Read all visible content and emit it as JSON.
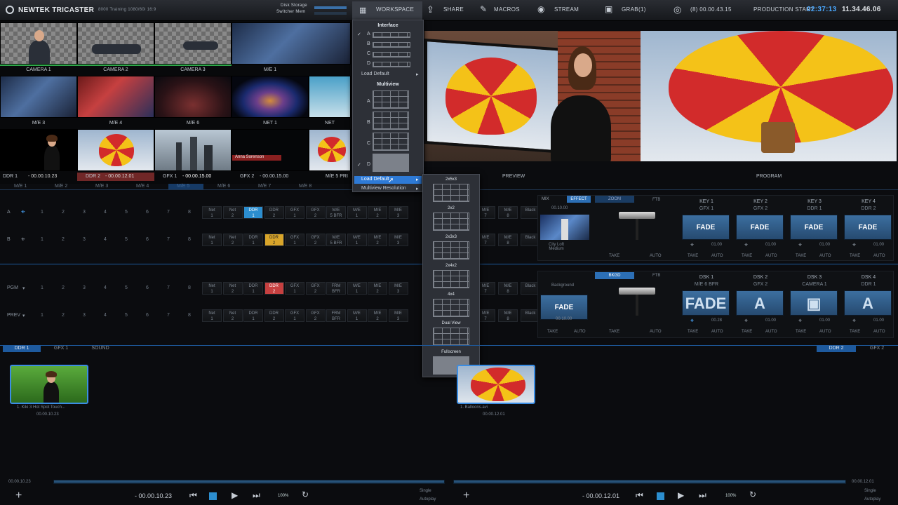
{
  "topbar": {
    "app": "NewTek TriCaster",
    "session": "8000 Training   1080/60i 16:9",
    "disk": "Disk Storage",
    "switcher": "Switcher Mem",
    "workspace": "WORKSPACE",
    "share": "SHARE",
    "macros": "MACROS",
    "stream": "STREAM",
    "grab": "GRAB",
    "grab_count": "(1)",
    "rec": "(8)  00.00.43.15",
    "prod_label": "PRODUCTION START",
    "prod_time": "02:37:13",
    "clock": "11.34.46.06"
  },
  "multiview": {
    "row1": [
      "CAMERA 1",
      "CAMERA 2",
      "CAMERA 3",
      "M/E 1"
    ],
    "row2": [
      "M/E 3",
      "M/E 4",
      "M/E 6",
      "NET 1",
      "NET"
    ],
    "row3": [
      "DDR 1",
      "DDR 2",
      "GFX 1",
      "GFX 2"
    ],
    "row3_times": [
      "- 00.00.10.23",
      "- 00.00.12.01",
      "- 00.00.15.00",
      "- 00.00.15.00"
    ],
    "preview": "PREVIEW",
    "program": "PROGRAM",
    "me5": "M/E 5 PRI",
    "caption": "Anna Sorenson"
  },
  "me_tabs": [
    "M/E 1",
    "M/E 2",
    "M/E 3",
    "M/E 4",
    "M/E 5",
    "M/E 6",
    "M/E 7",
    "M/E 8"
  ],
  "rows": {
    "a": "A",
    "b": "B",
    "pgm": "PGM",
    "prev": "PREV"
  },
  "buttons": [
    "1",
    "2",
    "3",
    "4",
    "5",
    "6",
    "7",
    "8"
  ],
  "src_labels": [
    "Net\n1",
    "Net\n2",
    "DDR\n1",
    "DDR\n2",
    "GFX\n1",
    "GFX\n2",
    "M/E\n5 BFR",
    "M/E\n1",
    "M/E\n2",
    "M/E\n3"
  ],
  "src_labels_pgm": [
    "Net\n1",
    "Net\n2",
    "DDR\n1",
    "DDR\n2",
    "GFX\n1",
    "GFX\n2",
    "FRM\nBFR",
    "M/E\n1",
    "M/E\n2",
    "M/E\n3"
  ],
  "me_right": [
    "M/E\n7",
    "M/E\n8",
    "Black"
  ],
  "transition": {
    "mix": "MIX",
    "effect": "EFFECT",
    "zoom": "ZOOM",
    "ftb": "FTB",
    "bkgd": "BKGD",
    "background": "Background",
    "city": "City Loft\nMedium",
    "time": "00.10.00",
    "fade": "FADE",
    "take": "TAKE",
    "auto": "AUTO",
    "rate": "01.00"
  },
  "keys": [
    {
      "t": "KEY 1",
      "s": "GFX 1"
    },
    {
      "t": "KEY 2",
      "s": "GFX 2"
    },
    {
      "t": "KEY 3",
      "s": "DDR 1"
    },
    {
      "t": "KEY 4",
      "s": "DDR 2"
    }
  ],
  "dsk": [
    {
      "t": "DSK 1",
      "s": "M/E 6 BFR"
    },
    {
      "t": "DSK 2",
      "s": "GFX 2"
    },
    {
      "t": "DSK 3",
      "s": "CAMERA 1"
    },
    {
      "t": "DSK 4",
      "s": "DDR 1"
    }
  ],
  "dsk_rate": "00.28",
  "media_tabs": [
    "DDR 1",
    "GFX 1",
    "SOUND"
  ],
  "media_tabs_r": [
    "DDR 2",
    "GFX 2"
  ],
  "clips": [
    {
      "name": "1. Kiki 3 Hot Spot Touch...",
      "dur": "00.00.10.23"
    },
    {
      "name": "1. Balloons.avi",
      "dur": "00.00.12.01"
    }
  ],
  "transport": {
    "l_time": "- 00.00.10.23",
    "r_time": "- 00.00.12.01",
    "zoom": "100%",
    "l_start": "00.00.10.23",
    "r_end": "00.00.12.01",
    "single": "Single",
    "autoplay": "Autoplay"
  },
  "menu": {
    "interface": "Interface",
    "opts": [
      "A",
      "B",
      "C",
      "D"
    ],
    "load_default": "Load Default",
    "multiview": "Multiview",
    "mv_opts": [
      "A",
      "B",
      "C",
      "D"
    ],
    "load_default2": "Load Default",
    "mv_res": "Multiview Resolution",
    "sub": [
      "2x5x3",
      "2x2",
      "2x3x3",
      "2x4x2",
      "4x4",
      "Dual View",
      "Fullscreen"
    ]
  }
}
